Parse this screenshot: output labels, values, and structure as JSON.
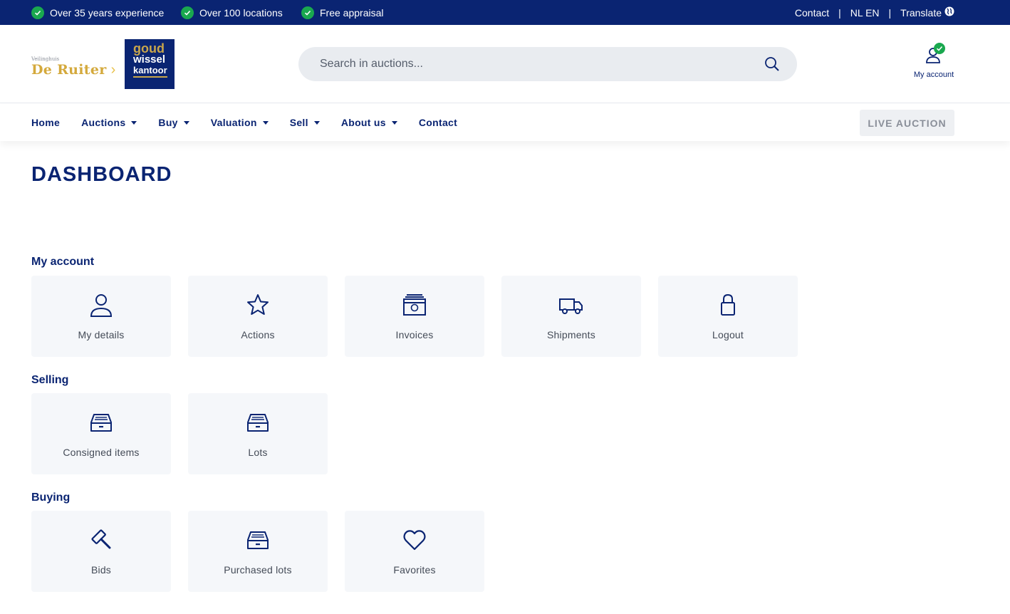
{
  "topbar": {
    "usps": [
      "Over 35 years experience",
      "Over 100 locations",
      "Free appraisal"
    ],
    "contact": "Contact",
    "languages": "NL EN",
    "translate": "Translate"
  },
  "header": {
    "logo_small": "Veilinghuis",
    "logo_main": "De Ruiter",
    "logo2_line1": "goud",
    "logo2_line2": "wissel",
    "logo2_line3": "kantoor",
    "search_placeholder": "Search in auctions...",
    "account_label": "My account"
  },
  "nav": {
    "items": [
      "Home",
      "Auctions",
      "Buy",
      "Valuation",
      "Sell",
      "About us",
      "Contact"
    ],
    "live_auction": "LIVE AUCTION"
  },
  "page": {
    "title": "DASHBOARD",
    "sections": [
      {
        "title": "My account",
        "tiles": [
          {
            "label": "My details",
            "icon": "user-icon"
          },
          {
            "label": "Actions",
            "icon": "star-icon"
          },
          {
            "label": "Invoices",
            "icon": "invoice-icon"
          },
          {
            "label": "Shipments",
            "icon": "truck-icon"
          },
          {
            "label": "Logout",
            "icon": "lock-icon"
          }
        ]
      },
      {
        "title": "Selling",
        "tiles": [
          {
            "label": "Consigned items",
            "icon": "drawer-icon"
          },
          {
            "label": "Lots",
            "icon": "drawer-icon"
          }
        ]
      },
      {
        "title": "Buying",
        "tiles": [
          {
            "label": "Bids",
            "icon": "gavel-icon"
          },
          {
            "label": "Purchased lots",
            "icon": "drawer-icon"
          },
          {
            "label": "Favorites",
            "icon": "heart-icon"
          }
        ]
      }
    ]
  },
  "colors": {
    "navy": "#0a2472",
    "green": "#1aa84f",
    "gold": "#d4a93c",
    "tile_bg": "#f5f7fa"
  }
}
